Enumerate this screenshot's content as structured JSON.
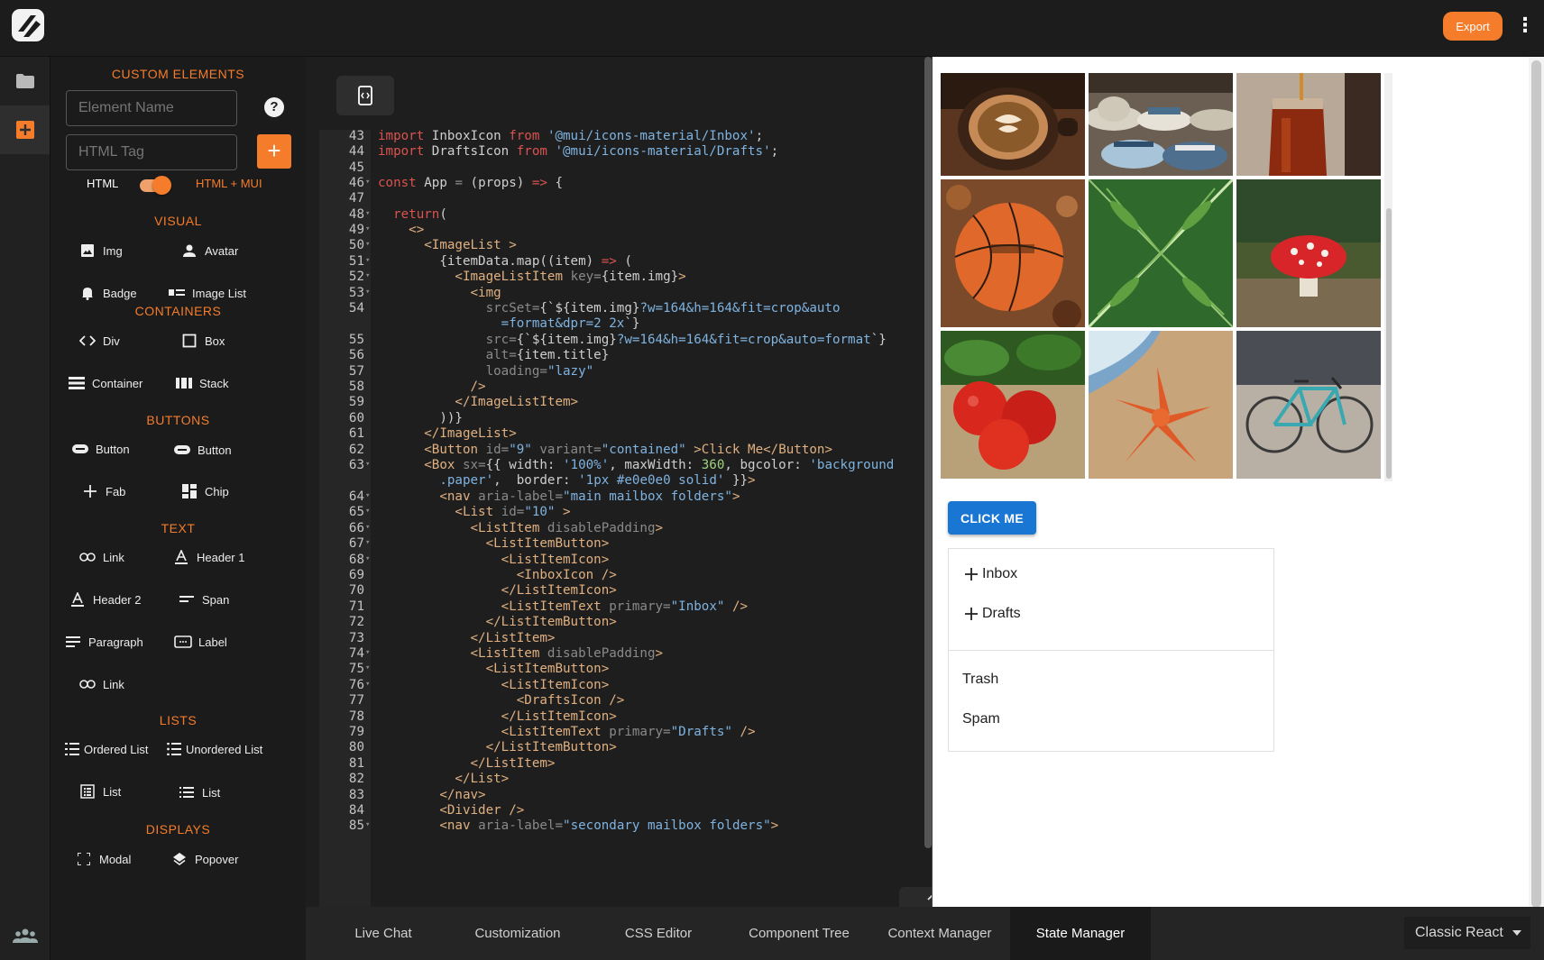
{
  "topbar": {
    "export_label": "Export"
  },
  "panel": {
    "custom_title": "CUSTOM ELEMENTS",
    "name_placeholder": "Element Name",
    "tag_placeholder": "HTML Tag",
    "help_glyph": "?",
    "add_glyph": "+",
    "toggle_left": "HTML",
    "toggle_right": "HTML + MUI",
    "toggle_on": true,
    "sections": [
      {
        "title": "VISUAL",
        "items": [
          "Img",
          "Avatar",
          "Badge",
          "Image List"
        ]
      },
      {
        "title": "CONTAINERS",
        "items": [
          "Div",
          "Box",
          "Container",
          "Stack"
        ]
      },
      {
        "title": "BUTTONS",
        "items": [
          "Button",
          "Button",
          "Fab",
          "Chip"
        ]
      },
      {
        "title": "TEXT",
        "items": [
          "Link",
          "Header 1",
          "Header 2",
          "Span",
          "Paragraph",
          "Label",
          "Link"
        ]
      },
      {
        "title": "LISTS",
        "items": [
          "Ordered List",
          "Unordered List",
          "List",
          "List"
        ]
      },
      {
        "title": "DISPLAYS",
        "items": [
          "Modal",
          "Popover"
        ]
      }
    ]
  },
  "editor": {
    "lines": [
      "43",
      "44",
      "45",
      "46",
      "47",
      "48",
      "49",
      "50",
      "51",
      "52",
      "53",
      "54",
      "",
      "55",
      "56",
      "57",
      "58",
      "59",
      "60",
      "61",
      "62",
      "63",
      "",
      "64",
      "65",
      "66",
      "67",
      "68",
      "69",
      "70",
      "71",
      "72",
      "73",
      "74",
      "75",
      "76",
      "77",
      "78",
      "79",
      "80",
      "81",
      "82",
      "83",
      "84",
      "85"
    ]
  },
  "bottombar": {
    "tabs": [
      "Live Chat",
      "Customization",
      "CSS Editor",
      "Component Tree",
      "Context Manager",
      "State Manager"
    ],
    "active_tab": "State Manager",
    "framework": "Classic React"
  },
  "preview": {
    "button_label": "CLICK ME",
    "primary_folders": [
      "Inbox",
      "Drafts"
    ],
    "secondary_folders": [
      "Trash",
      "Spam"
    ],
    "images": [
      "coffee",
      "hats",
      "honey",
      "basketball",
      "fern",
      "mushroom",
      "tomatoes",
      "starfish",
      "bike"
    ]
  },
  "colors": {
    "accent": "#f57c2a",
    "mui_primary": "#1976d2",
    "editor_bg": "#1e1e1e"
  }
}
